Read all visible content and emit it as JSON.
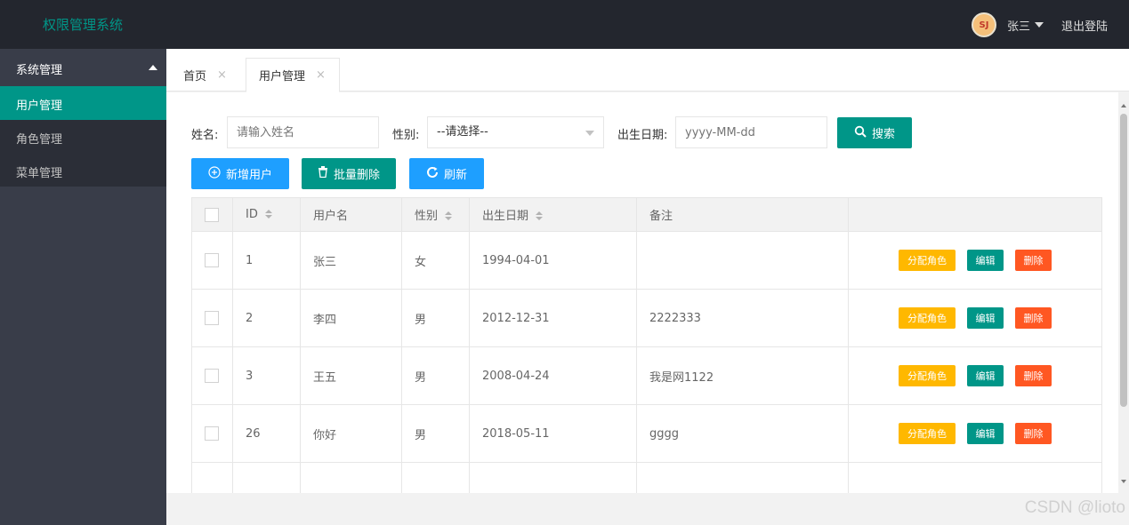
{
  "header": {
    "title": "权限管理系统",
    "avatar_text": "SJ",
    "username": "张三",
    "logout_label": "退出登陆"
  },
  "sidebar": {
    "group_label": "系统管理",
    "items": [
      {
        "label": "用户管理",
        "active": true
      },
      {
        "label": "角色管理",
        "active": false
      },
      {
        "label": "菜单管理",
        "active": false
      }
    ]
  },
  "tabs": [
    {
      "label": "首页",
      "close": "×",
      "active": false
    },
    {
      "label": "用户管理",
      "close": "×",
      "active": true
    }
  ],
  "search": {
    "name_label": "姓名:",
    "name_placeholder": "请输入姓名",
    "gender_label": "性别:",
    "gender_selected": "--请选择--",
    "birth_label": "出生日期:",
    "birth_placeholder": "yyyy-MM-dd",
    "search_label": "搜索"
  },
  "toolbar": {
    "add_label": "新增用户",
    "batch_delete_label": "批量删除",
    "refresh_label": "刷新"
  },
  "table": {
    "headers": {
      "id": "ID",
      "username": "用户名",
      "gender": "性别",
      "birth": "出生日期",
      "remark": "备注"
    },
    "rows": [
      {
        "id": "1",
        "username": "张三",
        "gender": "女",
        "birth": "1994-04-01",
        "remark": ""
      },
      {
        "id": "2",
        "username": "李四",
        "gender": "男",
        "birth": "2012-12-31",
        "remark": "2222333"
      },
      {
        "id": "3",
        "username": "王五",
        "gender": "男",
        "birth": "2008-04-24",
        "remark": "我是网1122"
      },
      {
        "id": "26",
        "username": "你好",
        "gender": "男",
        "birth": "2018-05-11",
        "remark": "gggg"
      }
    ],
    "actions": {
      "assign_role": "分配角色",
      "edit": "编辑",
      "delete": "删除"
    }
  },
  "colors": {
    "accent": "#009688",
    "header_bg": "#23262e",
    "sidebar_bg": "#393d49",
    "blue": "#1e9fff",
    "warn": "#ffb800",
    "danger": "#ff5722"
  },
  "watermark": "CSDN @lioto"
}
